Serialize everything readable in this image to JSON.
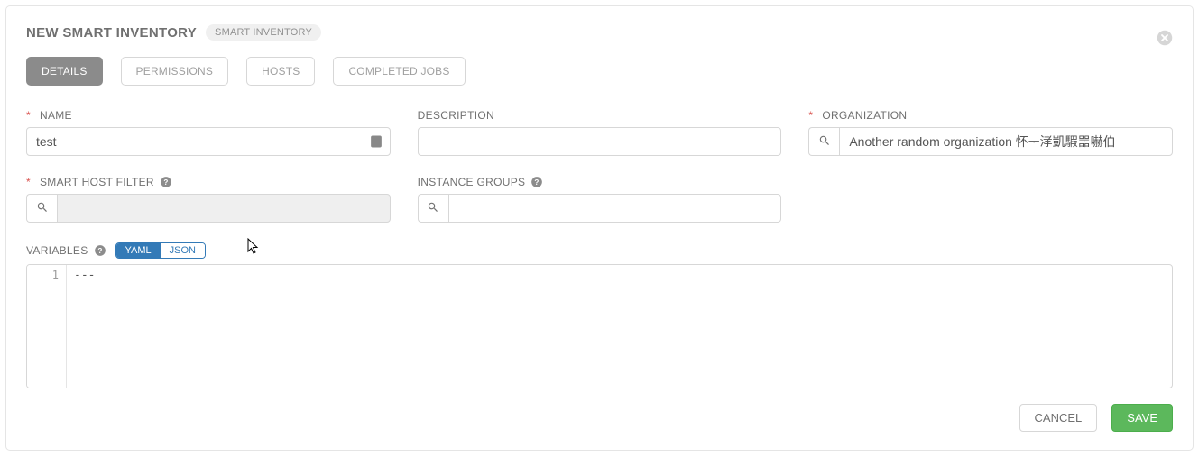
{
  "header": {
    "title": "NEW SMART INVENTORY",
    "badge": "SMART INVENTORY"
  },
  "tabs": {
    "details": "DETAILS",
    "permissions": "PERMISSIONS",
    "hosts": "HOSTS",
    "completed_jobs": "COMPLETED JOBS"
  },
  "fields": {
    "name_label": "NAME",
    "name_value": "test",
    "description_label": "DESCRIPTION",
    "description_value": "",
    "organization_label": "ORGANIZATION",
    "organization_value": "Another random organization 怀ᅮ涍￻凱騢噐￻嚇伯",
    "smart_host_filter_label": "SMART HOST FILTER",
    "smart_host_filter_value": "",
    "instance_groups_label": "INSTANCE GROUPS",
    "instance_groups_value": "",
    "variables_label": "VARIABLES"
  },
  "variables": {
    "mode_yaml": "YAML",
    "mode_json": "JSON",
    "line_number": "1",
    "content": "---"
  },
  "footer": {
    "cancel": "CANCEL",
    "save": "SAVE"
  }
}
